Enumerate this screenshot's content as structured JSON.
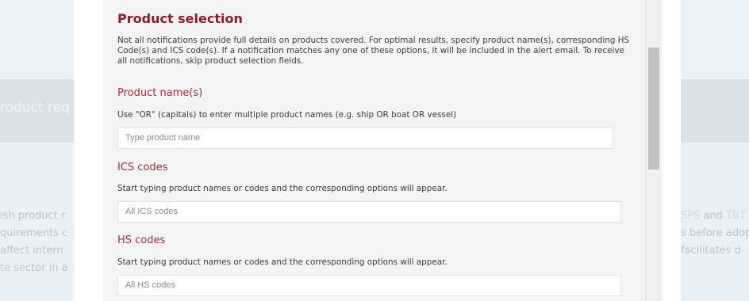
{
  "background": {
    "banner_text": "roduct req",
    "left_lines": [
      "ish product r",
      "quirements c",
      "affect intern",
      "te sector in a"
    ],
    "right_lines": [
      {
        "hl1": "SPS",
        "mid": " and ",
        "hl2": "TBT"
      },
      {
        "text": "s before adop"
      },
      {
        "text": "facilitates d"
      }
    ]
  },
  "modal": {
    "title": "Product selection",
    "description": "Not all notifications provide full details on products covered. For optimal results, specify product name(s), corresponding HS Code(s) and ICS code(s). If a notification matches any one of these options, it will be included in the alert email. To receive all notifications, skip product selection fields.",
    "product_names": {
      "heading": "Product name(s)",
      "hint": "Use \"OR\" (capitals) to enter multiple product names (e.g. ship OR boat OR vessel)",
      "placeholder": "Type product name"
    },
    "ics_codes": {
      "heading": "ICS codes",
      "hint": "Start typing product names or codes and the corresponding options will appear.",
      "placeholder": "All ICS codes"
    },
    "hs_codes": {
      "heading": "HS codes",
      "hint": "Start typing product names or codes and the corresponding options will appear.",
      "placeholder": "All HS codes"
    }
  }
}
